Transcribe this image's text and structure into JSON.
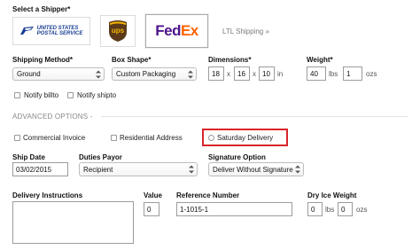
{
  "shipper": {
    "label": "Select a Shipper*",
    "carriers": [
      {
        "name": "USPS",
        "line1": "UNITED STATES",
        "line2": "POSTAL SERVICE"
      },
      {
        "name": "UPS",
        "text": "ups"
      },
      {
        "name": "FedEx",
        "fed": "Fed",
        "ex": "Ex",
        "selected": true
      }
    ],
    "ltl_link": "LTL Shipping »"
  },
  "shipping_method": {
    "label": "Shipping Method*",
    "value": "Ground"
  },
  "box_shape": {
    "label": "Box Shape*",
    "value": "Custom Packaging"
  },
  "dimensions": {
    "label": "Dimensions*",
    "length": "18",
    "width": "16",
    "height": "10",
    "sep1": "x",
    "sep2": "x",
    "unit": "in"
  },
  "weight": {
    "label": "Weight*",
    "lbs": "40",
    "lbs_unit": "lbs",
    "ozs": "1",
    "ozs_unit": "ozs"
  },
  "notify": {
    "billto": "Notify billto",
    "shipto": "Notify shipto"
  },
  "advanced": {
    "title": "ADVANCED OPTIONS -",
    "commercial_invoice": "Commercial Invoice",
    "residential_address": "Residential Address",
    "saturday_delivery": "Saturday Delivery"
  },
  "ship_date": {
    "label": "Ship Date",
    "value": "03/02/2015"
  },
  "duties_payor": {
    "label": "Duties Payor",
    "value": "Recipient"
  },
  "signature_option": {
    "label": "Signature Option",
    "value": "Deliver Without Signature"
  },
  "delivery_instructions": {
    "label": "Delivery Instructions",
    "value": ""
  },
  "value_field": {
    "label": "Value",
    "value": "0"
  },
  "reference_number": {
    "label": "Reference Number",
    "value": "1-1015-1"
  },
  "dry_ice": {
    "label": "Dry Ice Weight",
    "lbs": "0",
    "lbs_unit": "lbs",
    "ozs": "0",
    "ozs_unit": "ozs"
  },
  "colors": {
    "usps_blue": "#1b3f94",
    "ups_brown": "#5a3a1a",
    "ups_gold": "#f5b400",
    "fedex_purple": "#4d148c",
    "fedex_orange": "#ff6200",
    "highlight_red": "#d9262b"
  }
}
